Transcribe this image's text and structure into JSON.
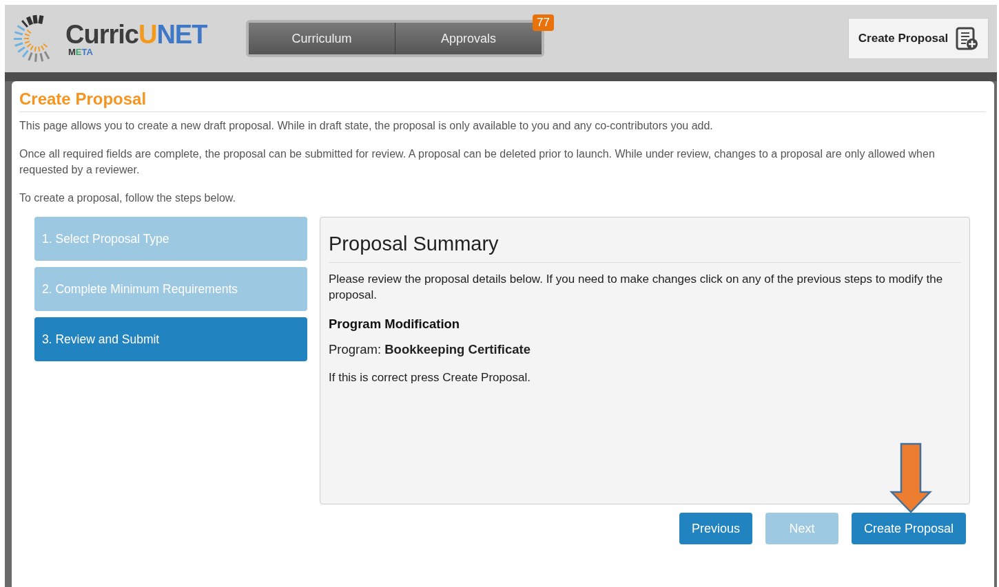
{
  "logo": {
    "parts": [
      {
        "text": "Curric",
        "color": "#3d3d3d"
      },
      {
        "text": "U",
        "color": "#f39a1e"
      },
      {
        "text": "NET",
        "color": "#3f78c6"
      }
    ],
    "sub_parts": [
      {
        "text": "M",
        "color": "#333333"
      },
      {
        "text": "E",
        "color": "#3aa66a"
      },
      {
        "text": "TA",
        "color": "#3f78c6"
      }
    ]
  },
  "nav": [
    {
      "label": "Curriculum"
    },
    {
      "label": "Approvals",
      "badge": "77"
    }
  ],
  "header_button": {
    "label": "Create Proposal"
  },
  "page": {
    "title": "Create Proposal",
    "paragraphs": [
      "This page allows you to create a new draft proposal. While in draft state, the proposal is only available to you and any co-contributors you add.",
      "Once all required fields are complete, the proposal can be submitted for review. A proposal can be deleted prior to launch. While under review, changes to a proposal are only allowed when requested by a reviewer.",
      "To create a proposal, follow the steps below."
    ]
  },
  "steps": [
    {
      "label": "1. Select Proposal Type",
      "selected": false
    },
    {
      "label": "2. Complete Minimum Requirements",
      "selected": false
    },
    {
      "label": "3. Review and Submit",
      "selected": true
    }
  ],
  "summary": {
    "title": "Proposal Summary",
    "intro": "Please review the proposal details below. If you need to make changes click on any of the previous steps to modify the proposal.",
    "type": "Program Modification",
    "program": "Program: **Bookkeeping Certificate**",
    "note": "If this is correct press Create Proposal."
  },
  "buttons": [
    {
      "label": "Previous",
      "disabled": false
    },
    {
      "label": "Next",
      "disabled": true
    },
    {
      "label": "Create Proposal",
      "disabled": false
    }
  ]
}
